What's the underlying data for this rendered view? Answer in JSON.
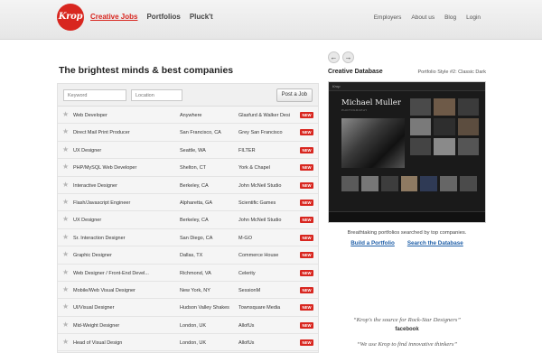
{
  "brand": {
    "logo_text": "Krop",
    "accent": "#d8261f",
    "link_color": "#1f5fa8"
  },
  "main_nav": [
    {
      "label": "Creative Jobs"
    },
    {
      "label": "Portfolios"
    },
    {
      "label": "Pluck't"
    }
  ],
  "secondary_nav": [
    {
      "label": "Employers"
    },
    {
      "label": "About us"
    },
    {
      "label": "Blog"
    },
    {
      "label": "Login"
    }
  ],
  "jobs": {
    "headline": "The brightest minds & best companies",
    "keyword_placeholder": "Keyword",
    "location_placeholder": "Location",
    "post_job_label": "Post a Job",
    "new_badge": "NEW",
    "listings": [
      {
        "title": "Web Developer",
        "location": "Anywhere",
        "company": "Glasfurd & Walker Desi"
      },
      {
        "title": "Direct Mail Print Producer",
        "location": "San Francisco, CA",
        "company": "Grey San Francisco"
      },
      {
        "title": "UX Designer",
        "location": "Seattle, WA",
        "company": "FILTER"
      },
      {
        "title": "PHP/MySQL Web Developer",
        "location": "Shelton, CT",
        "company": "York & Chapel"
      },
      {
        "title": "Interactive Designer",
        "location": "Berkeley, CA",
        "company": "John McNeil Studio"
      },
      {
        "title": "Flash/Javascript Engineer",
        "location": "Alpharetta, GA",
        "company": "Scientific Games"
      },
      {
        "title": "UX Designer",
        "location": "Berkeley, CA",
        "company": "John McNeil Studio"
      },
      {
        "title": "Sr. Interaction Designer",
        "location": "San Diego, CA",
        "company": "M-GO"
      },
      {
        "title": "Graphic Designer",
        "location": "Dallas, TX",
        "company": "Commerce House"
      },
      {
        "title": "Web Designer / Front-End Devel...",
        "location": "Richmond, VA",
        "company": "Celerity"
      },
      {
        "title": "Mobile/Web Visual Designer",
        "location": "New York, NY",
        "company": "SessionM"
      },
      {
        "title": "UI/Visual Designer",
        "location": "Hudson Valley Shakes",
        "company": "Townsquare Media"
      },
      {
        "title": "Mid-Weight Designer",
        "location": "London, UK",
        "company": "AllofUs"
      },
      {
        "title": "Head of Visual Design",
        "location": "London, UK",
        "company": "AllofUs"
      }
    ]
  },
  "creative_database": {
    "title": "Creative Database",
    "style_label": "Portfolio Style #2: Classic Dark",
    "preview_name": "Michael Muller",
    "preview_subtitle": "PHOTOGRAPHY",
    "caption": "Breathtaking portfolios searched by top companies.",
    "build_link": "Build a Portfolio",
    "search_link": "Search the Database"
  },
  "testimonials": [
    {
      "quote": "“Krop's the source for Rock-Star Designers”",
      "source": "facebook"
    },
    {
      "quote": "“We use Krop to find innovative thinkers”",
      "source": ""
    }
  ]
}
